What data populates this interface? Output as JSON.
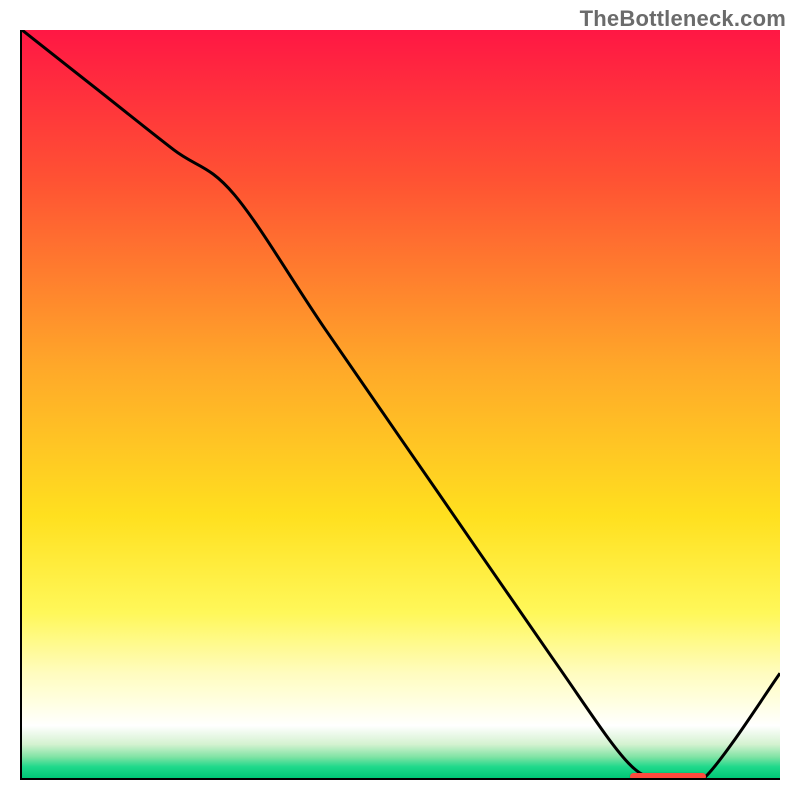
{
  "watermark": "TheBottleneck.com",
  "chart_data": {
    "type": "line",
    "title": "",
    "xlabel": "",
    "ylabel": "",
    "xlim": [
      0,
      100
    ],
    "ylim": [
      0,
      100
    ],
    "grid": false,
    "legend": false,
    "gradient_stops": [
      {
        "offset": 0,
        "color": "#ff1744"
      },
      {
        "offset": 0.2,
        "color": "#ff5233"
      },
      {
        "offset": 0.45,
        "color": "#ffa829"
      },
      {
        "offset": 0.65,
        "color": "#ffe01f"
      },
      {
        "offset": 0.78,
        "color": "#fff85a"
      },
      {
        "offset": 0.86,
        "color": "#fffcbf"
      },
      {
        "offset": 0.9,
        "color": "#ffffe2"
      },
      {
        "offset": 0.93,
        "color": "#ffffff"
      },
      {
        "offset": 0.955,
        "color": "#d4f2d0"
      },
      {
        "offset": 0.972,
        "color": "#7fe3a4"
      },
      {
        "offset": 0.985,
        "color": "#1fd98b"
      },
      {
        "offset": 1.0,
        "color": "#00c776"
      }
    ],
    "series": [
      {
        "name": "curve",
        "color": "#000000",
        "x": [
          0,
          10,
          20,
          28,
          40,
          55,
          70,
          80,
          85,
          90,
          100
        ],
        "y": [
          100,
          92,
          84,
          78,
          60,
          38,
          16,
          2,
          0,
          0,
          14
        ]
      }
    ],
    "markers": [
      {
        "name": "optimal-range",
        "color": "#ff4a3d",
        "x_start": 80,
        "x_end": 90,
        "y": 0.5,
        "thickness_pct": 1.0
      }
    ]
  }
}
